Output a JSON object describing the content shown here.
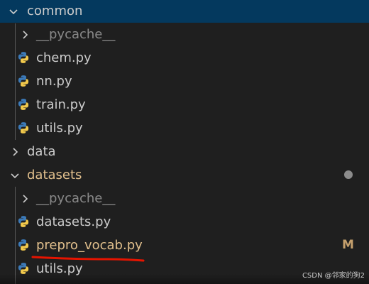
{
  "explorer": {
    "items": [
      {
        "label": "common",
        "kind": "folder",
        "state": "expanded",
        "icon": "chevron-down-icon"
      },
      {
        "label": "__pycache__",
        "kind": "folder",
        "state": "collapsed",
        "icon": "chevron-right-icon"
      },
      {
        "label": "chem.py",
        "kind": "file",
        "icon": "python-file-icon"
      },
      {
        "label": "nn.py",
        "kind": "file",
        "icon": "python-file-icon"
      },
      {
        "label": "train.py",
        "kind": "file",
        "icon": "python-file-icon"
      },
      {
        "label": "utils.py",
        "kind": "file",
        "icon": "python-file-icon"
      },
      {
        "label": "data",
        "kind": "folder",
        "state": "collapsed",
        "icon": "chevron-right-icon"
      },
      {
        "label": "datasets",
        "kind": "folder",
        "state": "expanded",
        "icon": "chevron-down-icon"
      },
      {
        "label": "__pycache__",
        "kind": "folder",
        "state": "collapsed",
        "icon": "chevron-right-icon"
      },
      {
        "label": "datasets.py",
        "kind": "file",
        "icon": "python-file-icon"
      },
      {
        "label": "prepro_vocab.py",
        "kind": "file",
        "icon": "python-file-icon",
        "status": "M"
      },
      {
        "label": "utils.py",
        "kind": "file",
        "icon": "python-file-icon"
      }
    ]
  },
  "colors": {
    "background": "#1f1f1f",
    "selected_row": "#04395e",
    "text": "#cccccc",
    "modified_text": "#e2c08d",
    "modified_badge": "#c5a06d",
    "annotation_red": "#e51400",
    "python_blue": "#3c7ab8",
    "python_yellow": "#f2c94c"
  },
  "watermark": "CSDN @邻家的狗2"
}
